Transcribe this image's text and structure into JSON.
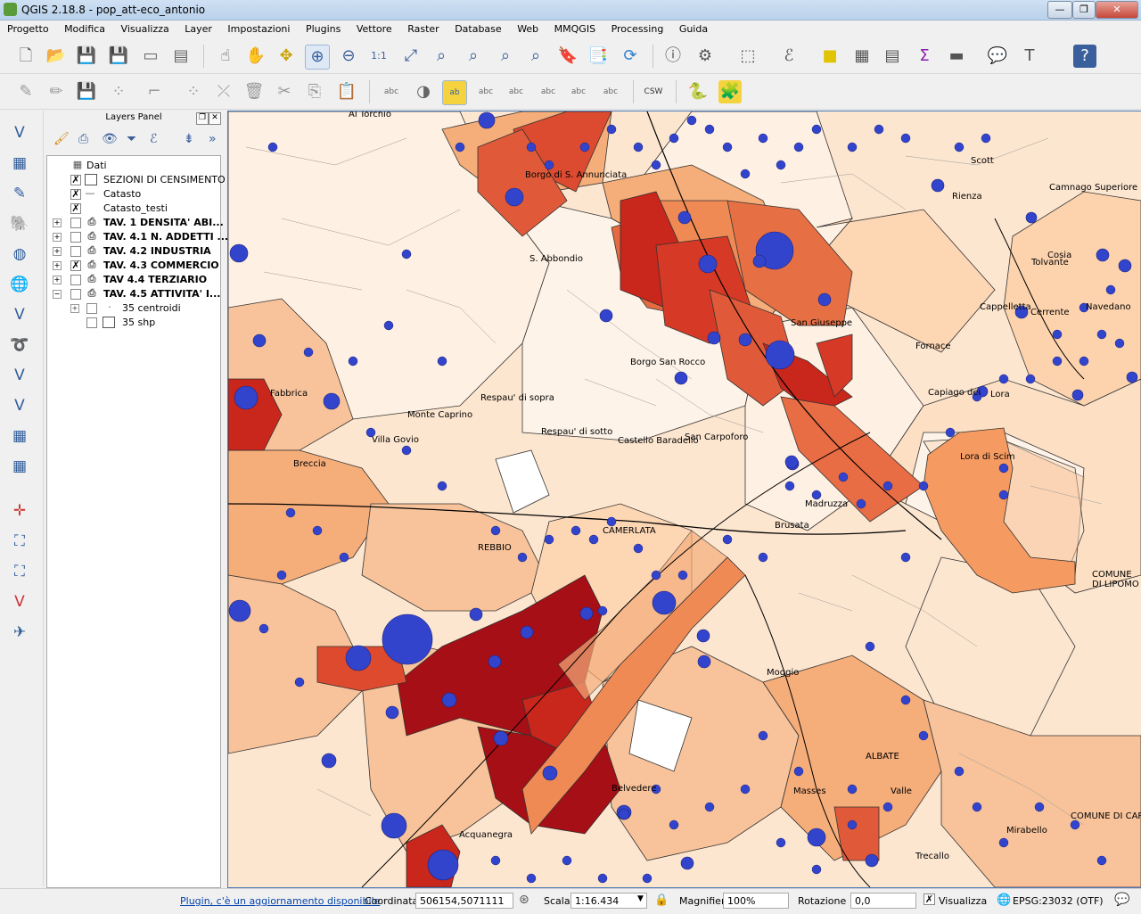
{
  "window": {
    "title": "QGIS 2.18.8 - pop_att-eco_antonio"
  },
  "menu": [
    "Progetto",
    "Modifica",
    "Visualizza",
    "Layer",
    "Impostazioni",
    "Plugins",
    "Vettore",
    "Raster",
    "Database",
    "Web",
    "MMQGIS",
    "Processing",
    "Guida"
  ],
  "layers_panel": {
    "title": "Layers Panel",
    "items": [
      {
        "label": "Dati",
        "checked": false
      },
      {
        "label": "SEZIONI DI CENSIMENTO",
        "checked": true
      },
      {
        "label": "Catasto",
        "checked": true
      },
      {
        "label": "Catasto_testi",
        "checked": true
      },
      {
        "label": "TAV. 1 DENSITA' ABI...",
        "checked": false
      },
      {
        "label": "TAV. 4.1 N. ADDETTI ...",
        "checked": false
      },
      {
        "label": "TAV. 4.2 INDUSTRIA",
        "checked": false
      },
      {
        "label": "TAV. 4.3 COMMERCIO",
        "checked": true
      },
      {
        "label": "TAV 4.4 TERZIARIO",
        "checked": false
      },
      {
        "label": "TAV. 4.5 ATTIVITA' I...",
        "checked": false
      },
      {
        "label": "35 centroidi",
        "checked": false
      },
      {
        "label": "35 shp",
        "checked": false
      }
    ]
  },
  "map": {
    "labels": [
      "Al Torchio",
      "Borgo di S. Annunciata",
      "S. Abbondio",
      "Scott",
      "Camnago Superiore",
      "Rienza",
      "Tolvante",
      "Cosia",
      "Cappelletta",
      "Cerrente",
      "Navedano",
      "San Giuseppe",
      "Borgo San Rocco",
      "Fornace",
      "Fabbrica",
      "Respau' di sopra",
      "Monte Caprino",
      "Respau' di sotto",
      "Castello Baradello",
      "San Carpoforo",
      "Villa Govio",
      "Breccia",
      "Lora di Scim",
      "Madruzza",
      "Brusata",
      "REBBIO",
      "CAMERLATA",
      "COMUNE DI LIPOMO",
      "Moggio",
      "ALBATE",
      "Belvedere",
      "Masses",
      "Valle",
      "Acquanegra",
      "Mirabello",
      "Trecallo",
      "COMUNE DI CAP",
      "Lora",
      "Capiago dei"
    ],
    "colors": {
      "fill_light": "#fde6d0",
      "fill_mid": "#f4b07e",
      "fill_dark": "#a50f15",
      "circle": "#3344cc",
      "border": "#4a78b5"
    }
  },
  "statusbar": {
    "plugin_msg": "Plugin, c'è un aggiornamento disponibile",
    "coord_label": "Coordinata",
    "coord_value": "506154,5071111",
    "scale_label": "Scala",
    "scale_value": "1:16.434",
    "magnifier_label": "Magnifier",
    "magnifier_value": "100%",
    "rotation_label": "Rotazione",
    "rotation_value": "0,0",
    "render_label": "Visualizza",
    "crs": "EPSG:23032 (OTF)"
  }
}
